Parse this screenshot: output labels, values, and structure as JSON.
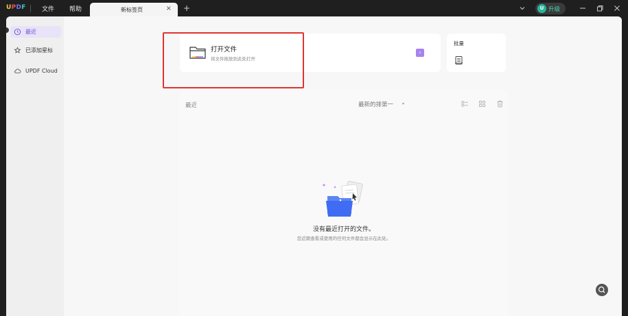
{
  "app": {
    "logo_letters": [
      "U",
      "P",
      "D",
      "F"
    ],
    "logo_colors": [
      "#f5c242",
      "#e8515d",
      "#6e7bf2",
      "#3fc3c0"
    ]
  },
  "menu": {
    "file": "文件",
    "help": "帮助"
  },
  "tabs": [
    {
      "label": "新标签页",
      "close": "×"
    }
  ],
  "tab_add": "+",
  "upgrade": {
    "badge": "U",
    "label": "升级"
  },
  "sidebar": {
    "items": [
      {
        "label": "最近",
        "icon": "clock-icon",
        "active": true
      },
      {
        "label": "已添加星标",
        "icon": "star-icon",
        "active": false
      },
      {
        "label": "UPDF Cloud",
        "icon": "cloud-icon",
        "active": false
      }
    ]
  },
  "open_file": {
    "title": "打开文件",
    "subtitle": "将文件拖放到此处打开",
    "arrow": "›"
  },
  "batch": {
    "title": "批量"
  },
  "recent": {
    "label": "最近",
    "sort": "最新的排第一",
    "sort_caret": "▾",
    "empty_title": "没有最近打开的文件。",
    "empty_subtitle": "您近期查看或使用的任何文件都会显示在此处。"
  },
  "colors": {
    "accent": "#6b50d6",
    "arrow_button": "#a783f0",
    "upgrade_badge": "#27b59a",
    "highlight": "#e1322f"
  }
}
